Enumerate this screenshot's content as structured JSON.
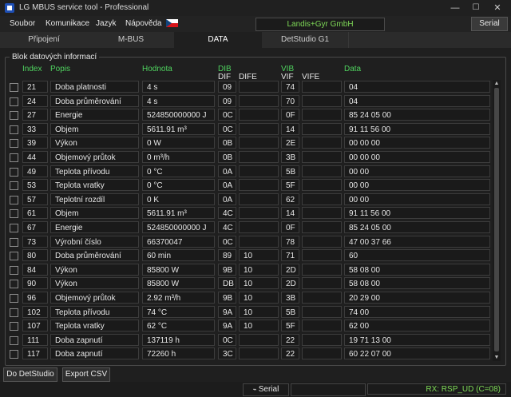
{
  "window": {
    "title": "LG MBUS service tool - Professional",
    "min": "—",
    "max": "☐",
    "close": "✕"
  },
  "menu": {
    "items": [
      "Soubor",
      "Komunikace",
      "Jazyk",
      "Nápověda"
    ]
  },
  "device": {
    "name": "Landis+Gyr GmbH"
  },
  "serial_button": "Serial",
  "tabs": [
    "Připojení",
    "M-BUS",
    "DATA",
    "DetStudio G1"
  ],
  "active_tab": 2,
  "group_title": "Blok datových informací",
  "headers": {
    "index": "Index",
    "popis": "Popis",
    "hodnota": "Hodnota",
    "dib": "DIB",
    "dif": "DIF",
    "dife": "DIFE",
    "vib": "VIB",
    "vif": "VIF",
    "vife": "VIFE",
    "data": "Data"
  },
  "rows": [
    {
      "index": "21",
      "popis": "Doba platnosti",
      "hodnota": "4 s",
      "dif": "09",
      "dife": "",
      "vif": "74",
      "vife": "",
      "data": "04"
    },
    {
      "index": "24",
      "popis": "Doba průměrování",
      "hodnota": "4 s",
      "dif": "09",
      "dife": "",
      "vif": "70",
      "vife": "",
      "data": "04"
    },
    {
      "index": "27",
      "popis": "Energie",
      "hodnota": "524850000000 J",
      "dif": "0C",
      "dife": "",
      "vif": "0F",
      "vife": "",
      "data": "85 24 05 00"
    },
    {
      "index": "33",
      "popis": "Objem",
      "hodnota": "5611.91 m³",
      "dif": "0C",
      "dife": "",
      "vif": "14",
      "vife": "",
      "data": "91 11 56 00"
    },
    {
      "index": "39",
      "popis": "Výkon",
      "hodnota": "0 W",
      "dif": "0B",
      "dife": "",
      "vif": "2E",
      "vife": "",
      "data": "00 00 00"
    },
    {
      "index": "44",
      "popis": "Objemový průtok",
      "hodnota": "0 m³/h",
      "dif": "0B",
      "dife": "",
      "vif": "3B",
      "vife": "",
      "data": "00 00 00"
    },
    {
      "index": "49",
      "popis": "Teplota přívodu",
      "hodnota": "0 °C",
      "dif": "0A",
      "dife": "",
      "vif": "5B",
      "vife": "",
      "data": "00 00"
    },
    {
      "index": "53",
      "popis": "Teplota vratky",
      "hodnota": "0 °C",
      "dif": "0A",
      "dife": "",
      "vif": "5F",
      "vife": "",
      "data": "00 00"
    },
    {
      "index": "57",
      "popis": "Teplotní rozdíl",
      "hodnota": "0 K",
      "dif": "0A",
      "dife": "",
      "vif": "62",
      "vife": "",
      "data": "00 00"
    },
    {
      "index": "61",
      "popis": "Objem",
      "hodnota": "5611.91 m³",
      "dif": "4C",
      "dife": "",
      "vif": "14",
      "vife": "",
      "data": "91 11 56 00"
    },
    {
      "index": "67",
      "popis": "Energie",
      "hodnota": "524850000000 J",
      "dif": "4C",
      "dife": "",
      "vif": "0F",
      "vife": "",
      "data": "85 24 05 00"
    },
    {
      "index": "73",
      "popis": "Výrobní číslo",
      "hodnota": "66370047",
      "dif": "0C",
      "dife": "",
      "vif": "78",
      "vife": "",
      "data": "47 00 37 66"
    },
    {
      "index": "80",
      "popis": "Doba průměrování",
      "hodnota": "60 min",
      "dif": "89",
      "dife": "10",
      "vif": "71",
      "vife": "",
      "data": "60"
    },
    {
      "index": "84",
      "popis": "Výkon",
      "hodnota": "85800 W",
      "dif": "9B",
      "dife": "10",
      "vif": "2D",
      "vife": "",
      "data": "58 08 00"
    },
    {
      "index": "90",
      "popis": "Výkon",
      "hodnota": "85800 W",
      "dif": "DB",
      "dife": "10",
      "vif": "2D",
      "vife": "",
      "data": "58 08 00"
    },
    {
      "index": "96",
      "popis": "Objemový průtok",
      "hodnota": "2.92 m³/h",
      "dif": "9B",
      "dife": "10",
      "vif": "3B",
      "vife": "",
      "data": "20 29 00"
    },
    {
      "index": "102",
      "popis": "Teplota přívodu",
      "hodnota": "74 °C",
      "dif": "9A",
      "dife": "10",
      "vif": "5B",
      "vife": "",
      "data": "74 00"
    },
    {
      "index": "107",
      "popis": "Teplota vratky",
      "hodnota": "62 °C",
      "dif": "9A",
      "dife": "10",
      "vif": "5F",
      "vife": "",
      "data": "62 00"
    },
    {
      "index": "111",
      "popis": "Doba zapnutí",
      "hodnota": "137119 h",
      "dif": "0C",
      "dife": "",
      "vif": "22",
      "vife": "",
      "data": "19 71 13 00"
    },
    {
      "index": "117",
      "popis": "Doba zapnutí",
      "hodnota": "72260 h",
      "dif": "3C",
      "dife": "",
      "vif": "22",
      "vife": "",
      "data": "60 22 07 00"
    }
  ],
  "buttons": {
    "to_detstudio": "Do DetStudio",
    "export_csv": "Export CSV"
  },
  "status": {
    "serial_label": "Serial",
    "rx": "RX: RSP_UD (C=08)"
  },
  "colors": {
    "accent_green": "#4fd35f",
    "background": "#1f1f1f"
  }
}
